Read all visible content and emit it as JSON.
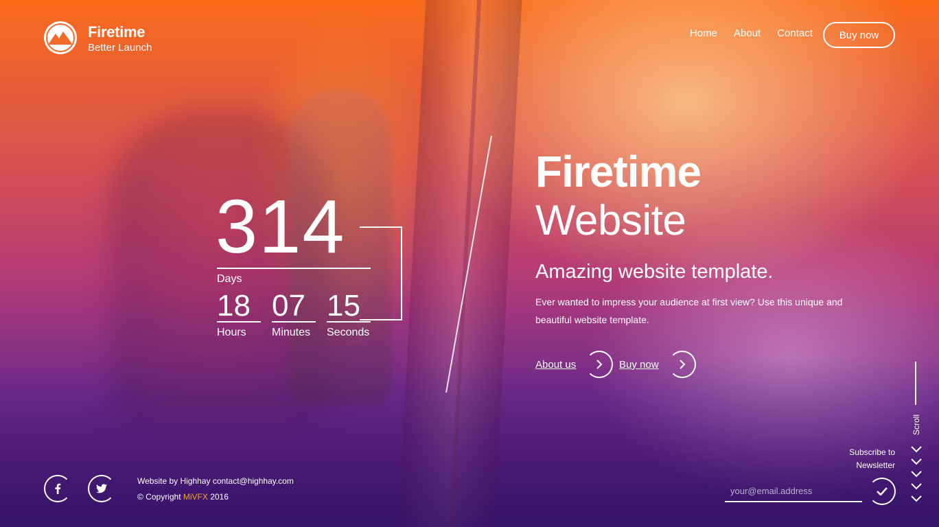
{
  "brand": {
    "name": "Firetime",
    "tagline": "Better Launch"
  },
  "nav": {
    "items": [
      "Home",
      "About",
      "Contact"
    ],
    "buy_label": "Buy now"
  },
  "countdown": {
    "days": "314",
    "days_label": "Days",
    "hours": "18",
    "hours_label": "Hours",
    "minutes": "07",
    "minutes_label": "Minutes",
    "seconds": "15",
    "seconds_label": "Seconds"
  },
  "hero": {
    "title_bold": "Firetime",
    "title_light": "Website",
    "tagline": "Amazing website template.",
    "description": "Ever wanted to impress your audience at first view? Use this unique and beautiful website template.",
    "cta_about": "About us",
    "cta_buy": "Buy now"
  },
  "scroll": {
    "label": "Scroll"
  },
  "footer": {
    "credit_line": "Website by Highhay contact@highhay.com",
    "copyright_prefix": "© Copyright ",
    "copyright_brand": "MiVFX",
    "copyright_year": " 2016",
    "social": [
      "facebook-icon",
      "twitter-icon"
    ]
  },
  "newsletter": {
    "label_line1": "Subscribe to",
    "label_line2": "Newsletter",
    "placeholder": "your@email.address"
  },
  "colors": {
    "accent": "#f5a623",
    "text": "#ffffff"
  }
}
